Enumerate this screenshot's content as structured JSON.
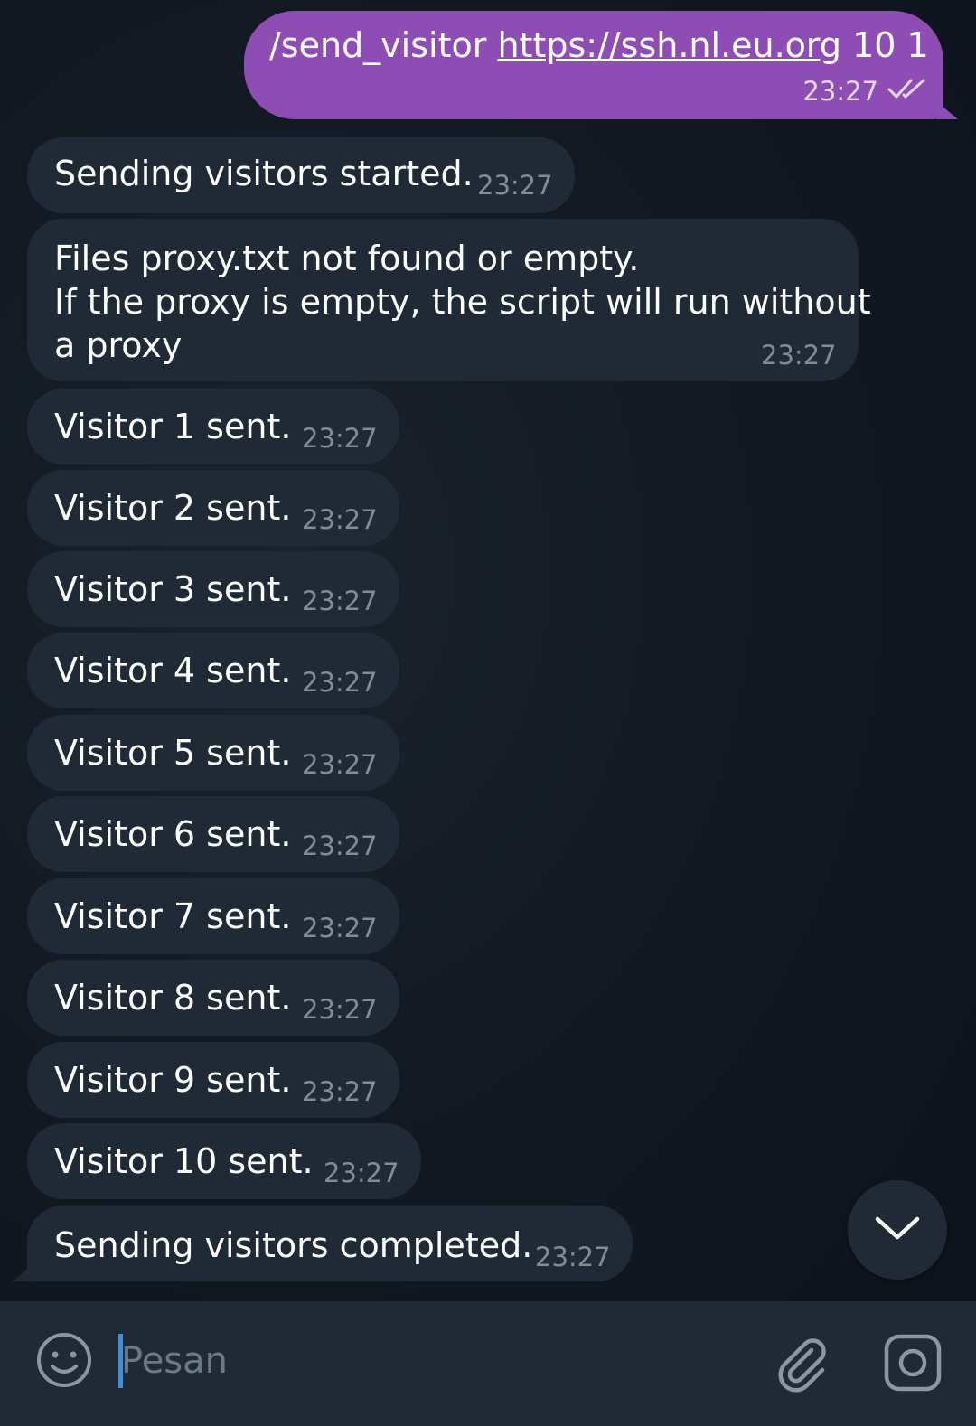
{
  "outgoing": {
    "command": "/send_visitor",
    "link": "https://ssh.nl.eu.org",
    "args": "10 1",
    "time": "23:27"
  },
  "incoming": [
    {
      "text": "Sending visitors started.",
      "time": "23:27"
    },
    {
      "line1": "Files proxy.txt not found or empty.",
      "line2": "If the proxy is empty, the script will run without",
      "line3": "a proxy",
      "time": "23:27"
    },
    {
      "text": "Visitor 1 sent.",
      "time": "23:27"
    },
    {
      "text": "Visitor 2 sent.",
      "time": "23:27"
    },
    {
      "text": "Visitor 3 sent.",
      "time": "23:27"
    },
    {
      "text": "Visitor 4 sent.",
      "time": "23:27"
    },
    {
      "text": "Visitor 5 sent.",
      "time": "23:27"
    },
    {
      "text": "Visitor 6 sent.",
      "time": "23:27"
    },
    {
      "text": "Visitor 7 sent.",
      "time": "23:27"
    },
    {
      "text": "Visitor 8 sent.",
      "time": "23:27"
    },
    {
      "text": "Visitor 9 sent.",
      "time": "23:27"
    },
    {
      "text": "Visitor 10 sent.",
      "time": "23:27"
    },
    {
      "text": "Sending visitors completed.",
      "time": "23:27"
    }
  ],
  "input": {
    "placeholder": "Pesan",
    "value": ""
  },
  "icons": {
    "emoji": "smiley-icon",
    "attach": "paperclip-icon",
    "camera": "instagram-camera-icon",
    "scroll": "chevron-down-icon",
    "read": "double-check-icon"
  },
  "colors": {
    "outgoing_bubble": "#8d4db5",
    "incoming_bubble": "#1f2a36",
    "background": "#0f161f",
    "timestamp": "#7f8c99",
    "caret": "#3f8fe0"
  }
}
